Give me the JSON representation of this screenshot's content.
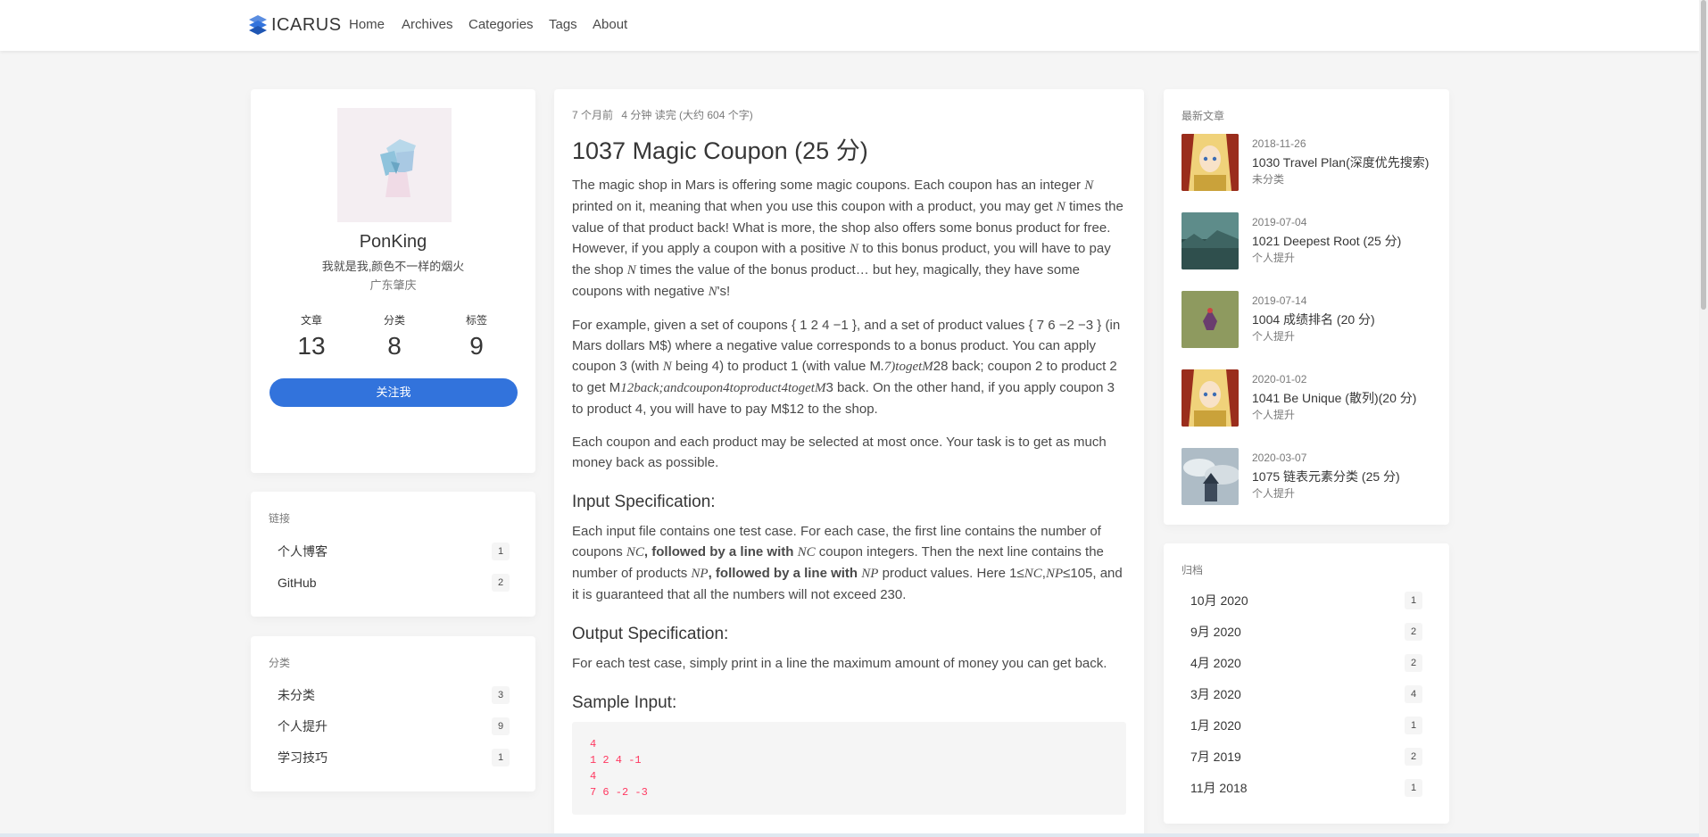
{
  "nav": {
    "brand": "ICARUS",
    "items": [
      "Home",
      "Archives",
      "Categories",
      "Tags",
      "About"
    ]
  },
  "profile": {
    "name": "PonKing",
    "bio": "我就是我,颜色不一样的烟火",
    "location": "广东肇庆",
    "stats": [
      {
        "label": "文章",
        "value": "13"
      },
      {
        "label": "分类",
        "value": "8"
      },
      {
        "label": "标签",
        "value": "9"
      }
    ],
    "follow_label": "关注我"
  },
  "links": {
    "title": "链接",
    "items": [
      {
        "label": "个人博客",
        "count": "1"
      },
      {
        "label": "GitHub",
        "count": "2"
      }
    ]
  },
  "categories": {
    "title": "分类",
    "items": [
      {
        "label": "未分类",
        "count": "3"
      },
      {
        "label": "个人提升",
        "count": "9"
      },
      {
        "label": "学习技巧",
        "count": "1"
      }
    ]
  },
  "article": {
    "meta": {
      "time": "7 个月前",
      "read": "4 分钟 读完 (大约 604 个字)"
    },
    "title": "1037 Magic Coupon (25 分)",
    "p1": [
      "The magic shop in Mars is offering some magic coupons. Each coupon has an integer ",
      "N",
      " printed on it, meaning that when you use this coupon with a product, you may get ",
      "N",
      " times the value of that product back! What is more, the shop also offers some bonus product for free. However, if you apply a coupon with a positive ",
      "N",
      " to this bonus product, you will have to pay the shop ",
      "N",
      " times the value of the bonus product… but hey, magically, they have some coupons with negative ",
      "N",
      "'s!"
    ],
    "p2": [
      "For example, given a set of coupons { 1 2 4 −1 }, and a set of product values { 7 6 −2 −3 } (in Mars dollars M$) where a negative value corresponds to a bonus product. You can apply coupon 3 (with ",
      "N",
      " being 4) to product 1 (with value M",
      ".7)togetM",
      "28 back; coupon 2 to product 2 to get M",
      "12back;andcoupon4toproduct4togetM",
      "3 back. On the other hand, if you apply coupon 3 to product 4, you will have to pay M$12 to the shop."
    ],
    "p3": "Each coupon and each product may be selected at most once. Your task is to get as much money back as possible.",
    "h_input": "Input Specification:",
    "p4": [
      "Each input file contains one test case. For each case, the first line contains the number of coupons ",
      "NC",
      ", followed by a line with ",
      "NC",
      " coupon integers. Then the next line contains the number of products ",
      "NP",
      ", followed by a line with ",
      "NP",
      " product values. Here 1≤",
      "NC",
      ",",
      "NP",
      "≤105, and it is guaranteed that all the numbers will not exceed 230."
    ],
    "h_output": "Output Specification:",
    "p5": "For each test case, simply print in a line the maximum amount of money you can get back.",
    "h_sample": "Sample Input:",
    "sample": "4\n1 2 4 -1\n4\n7 6 -2 -3"
  },
  "recent": {
    "title": "最新文章",
    "items": [
      {
        "date": "2018-11-26",
        "title": "1030 Travel Plan(深度优先搜索)",
        "category": "未分类",
        "thumb": "anime-girl"
      },
      {
        "date": "2019-07-04",
        "title": "1021 Deepest Root (25 分)",
        "category": "个人提升",
        "thumb": "teal-landscape"
      },
      {
        "date": "2019-07-14",
        "title": "1004 成绩排名 (20 分)",
        "category": "个人提升",
        "thumb": "olive-figure"
      },
      {
        "date": "2020-01-02",
        "title": "1041 Be Unique (散列)(20 分)",
        "category": "个人提升",
        "thumb": "anime-girl"
      },
      {
        "date": "2020-03-07",
        "title": "1075 链表元素分类 (25 分)",
        "category": "个人提升",
        "thumb": "cloud-castle"
      }
    ]
  },
  "archives": {
    "title": "归档",
    "items": [
      {
        "label": "10月 2020",
        "count": "1"
      },
      {
        "label": "9月 2020",
        "count": "2"
      },
      {
        "label": "4月 2020",
        "count": "2"
      },
      {
        "label": "3月 2020",
        "count": "4"
      },
      {
        "label": "1月 2020",
        "count": "1"
      },
      {
        "label": "7月 2019",
        "count": "2"
      },
      {
        "label": "11月 2018",
        "count": "1"
      }
    ]
  },
  "colors": {
    "accent": "#3273dc",
    "code": "#ff3860"
  }
}
